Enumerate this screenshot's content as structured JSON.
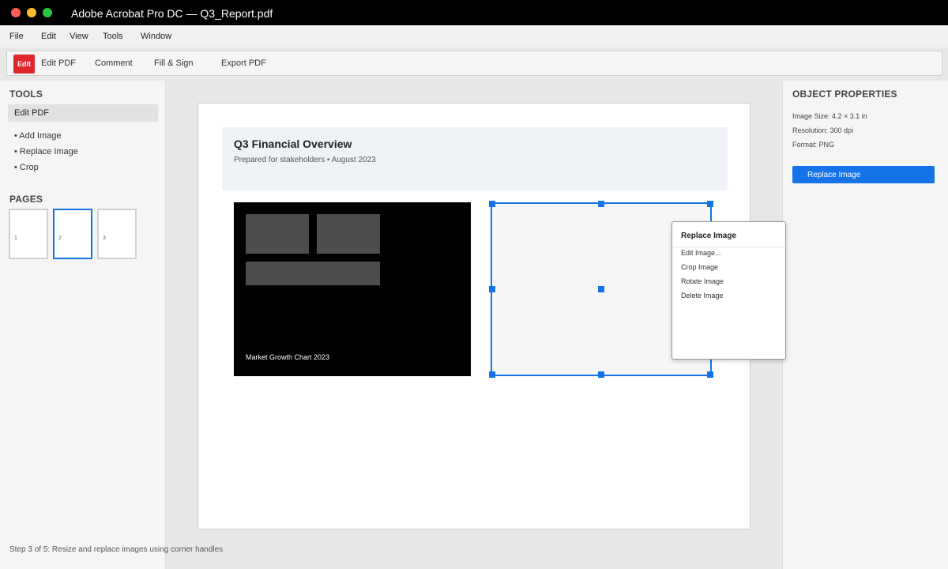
{
  "window": {
    "title": "Adobe Acrobat Pro DC — Q3_Report.pdf"
  },
  "menu": {
    "items": [
      "File",
      "Edit",
      "View",
      "Tools",
      "Window"
    ]
  },
  "toolbar": {
    "badge": "Edit",
    "items": [
      "Edit PDF",
      "Comment",
      "Fill & Sign",
      "Export PDF"
    ],
    "badge_color": "#e0262a"
  },
  "left_panel": {
    "tools_heading": "TOOLS",
    "active_tool": "Edit PDF",
    "sub_tools": [
      "• Add Image",
      "• Replace Image",
      "• Crop"
    ],
    "pages_heading": "PAGES",
    "pages": [
      "1",
      "2",
      "3"
    ],
    "active_page": "2",
    "step_text": "Step 3 of 5: Resize and replace images using corner handles"
  },
  "document": {
    "title": "Q3 Financial Overview",
    "subtitle": "Prepared for stakeholders • August 2023",
    "image_caption": "Market Growth Chart 2023"
  },
  "context_menu": {
    "title": "Replace Image",
    "items": [
      "Edit Image...",
      "Crop Image",
      "Rotate Image",
      "Delete Image"
    ]
  },
  "right_panel": {
    "heading": "OBJECT PROPERTIES",
    "image_size": "Image Size: 4.2 × 3.1 in",
    "resolution": "Resolution: 300 dpi",
    "format": "Format: PNG",
    "replace_button": "Replace Image",
    "accent_color": "#1473e6"
  }
}
